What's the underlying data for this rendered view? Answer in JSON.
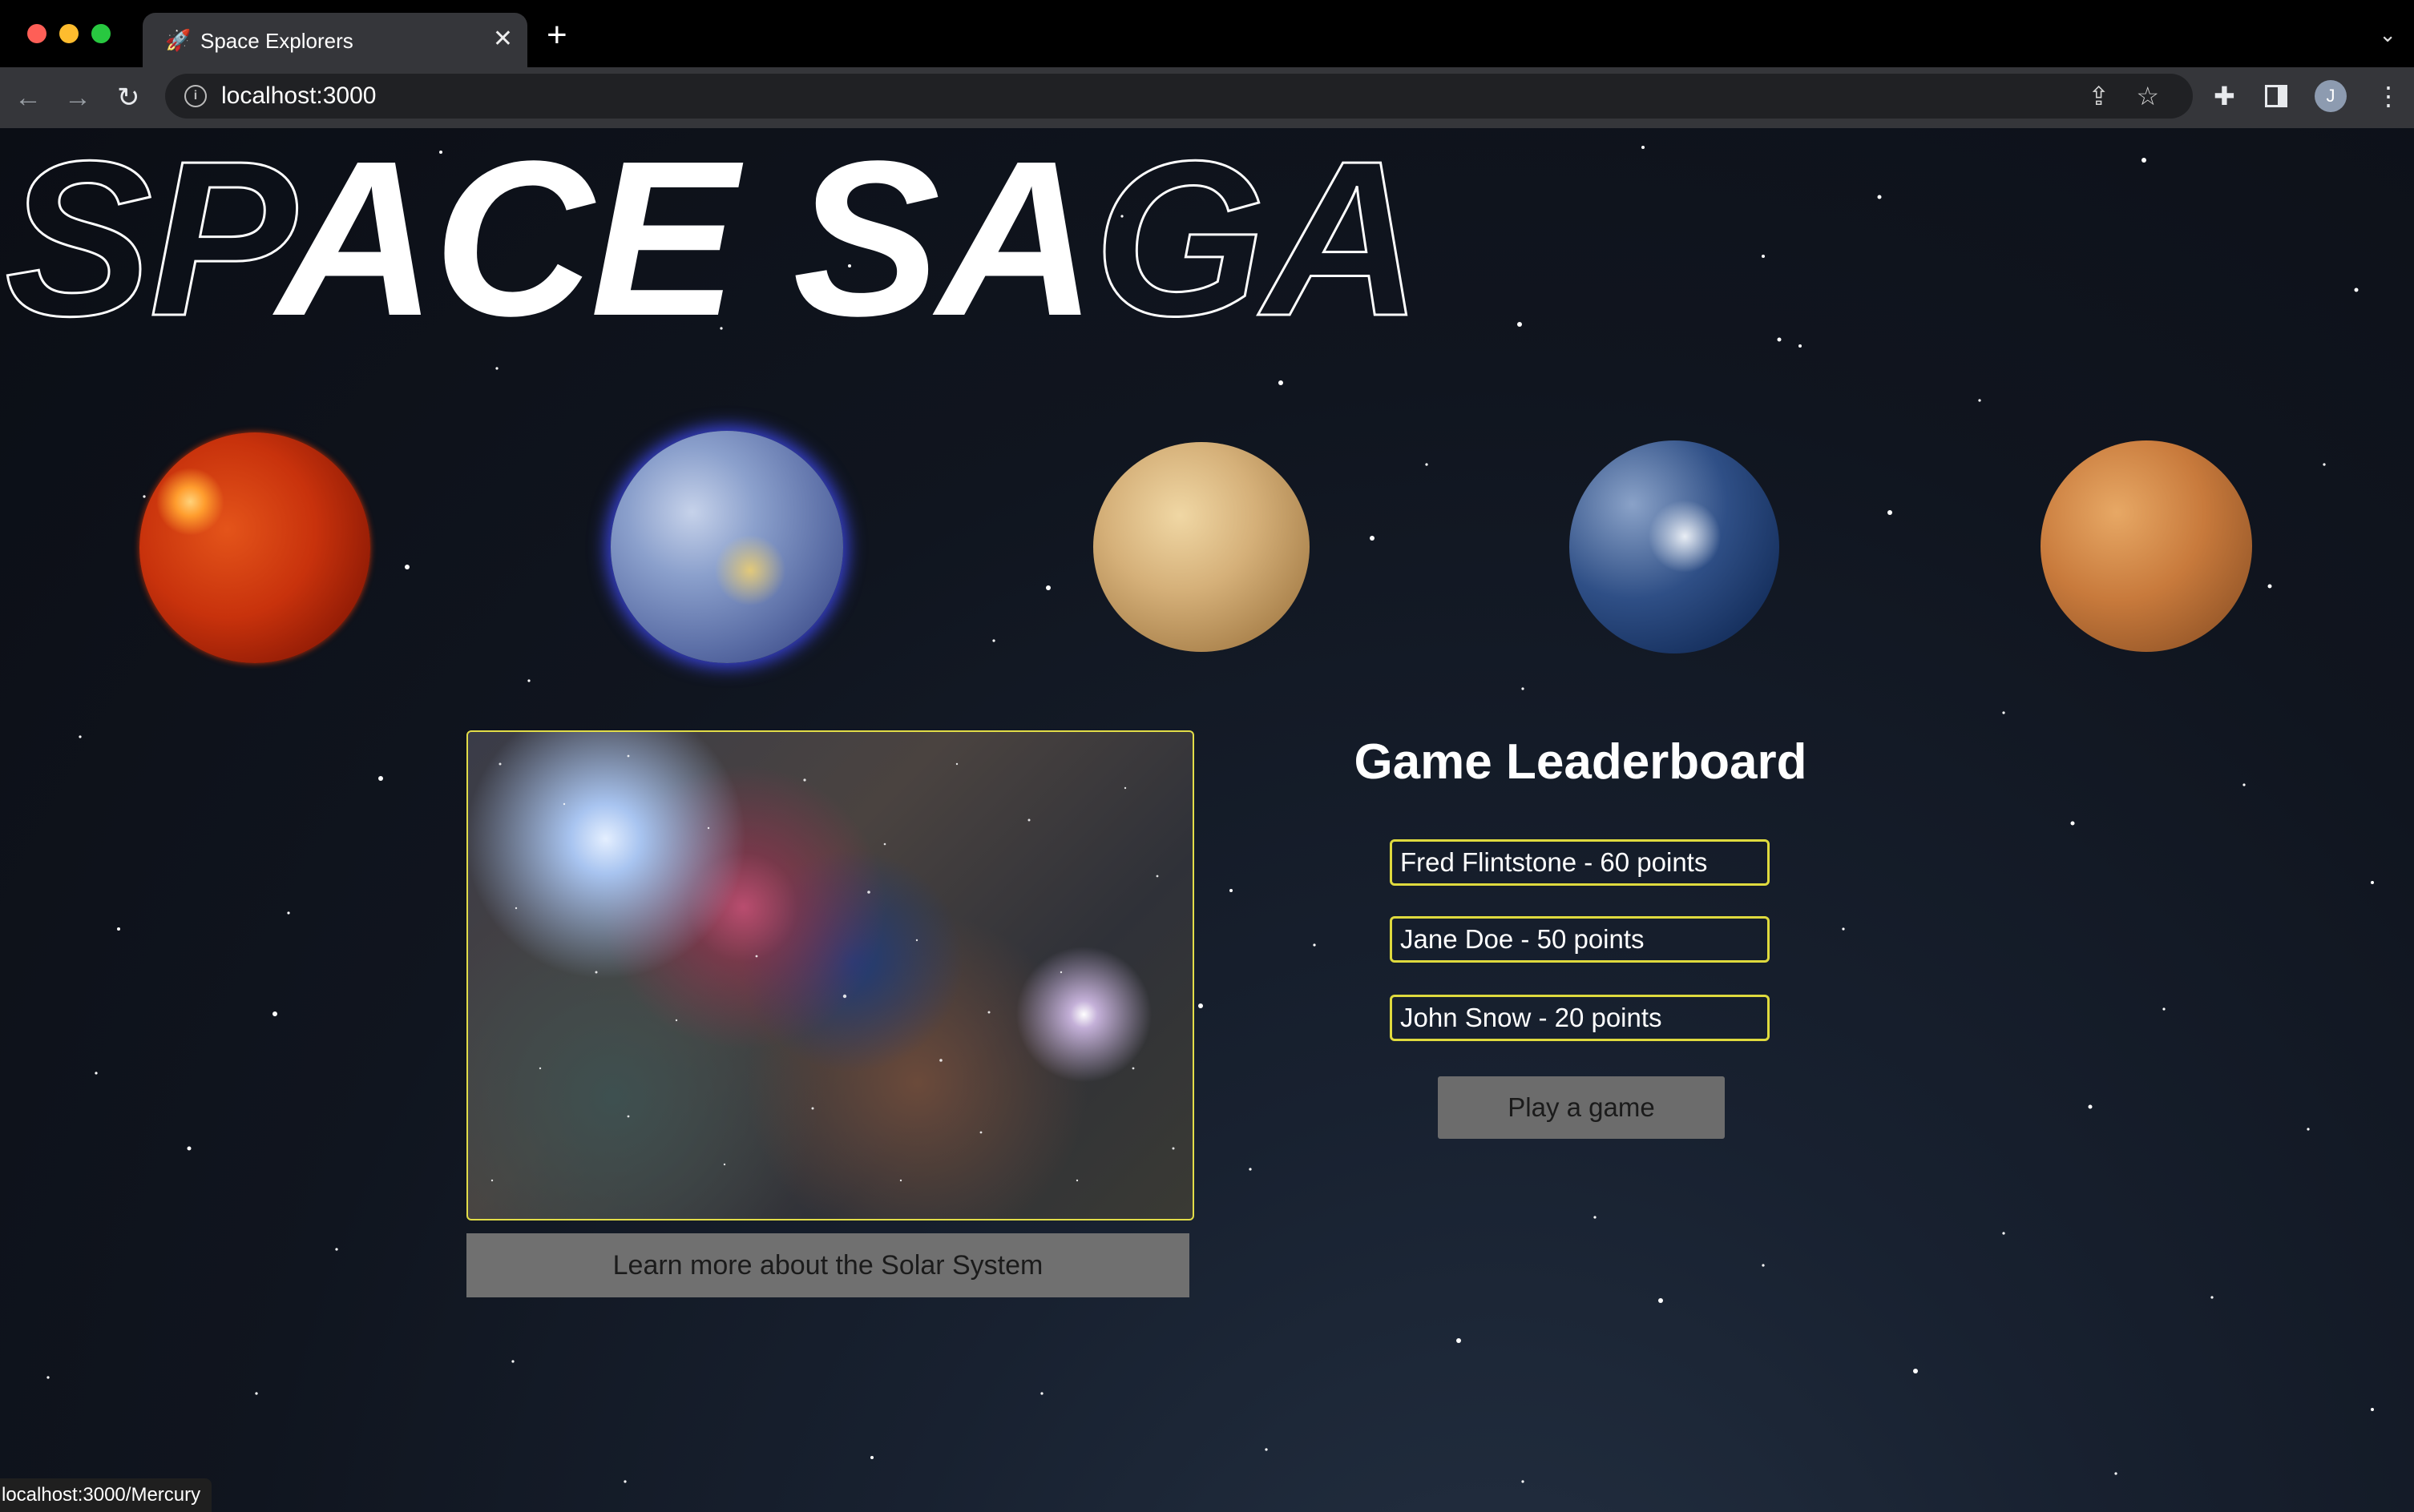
{
  "browser": {
    "tab": {
      "favicon": "🚀",
      "title": "Space Explorers",
      "close": "✕"
    },
    "new_tab": "+",
    "tab_menu": "⌄",
    "back": "←",
    "forward": "→",
    "reload": "↻",
    "info": "i",
    "url": "localhost:3000",
    "share": "⇪",
    "star": "☆",
    "extensions": "✚",
    "profile_initial": "J",
    "menu": "⋮",
    "status_url": "localhost:3000/Mercury"
  },
  "hero": {
    "title_outline_1": "SP",
    "title_solid_1": "ACE ",
    "title_outline_2": "",
    "title_solid_2": "SA",
    "title_outline_3": "GA"
  },
  "planets": [
    {
      "name": "Sun",
      "icon": "sun"
    },
    {
      "name": "Mercury",
      "icon": "mercury"
    },
    {
      "name": "Venus",
      "icon": "venus"
    },
    {
      "name": "Earth",
      "icon": "earth"
    },
    {
      "name": "Mars",
      "icon": "mars"
    }
  ],
  "solar_system": {
    "button_label": "Learn more about the Solar System",
    "accent": "#e2dd48"
  },
  "leaderboard": {
    "title": "Game Leaderboard",
    "entries": [
      "Fred Flintstone - 60 points",
      "Jane Doe - 50 points",
      "John Snow - 20 points"
    ],
    "play_label": "Play a game",
    "accent": "#dfda3e"
  }
}
